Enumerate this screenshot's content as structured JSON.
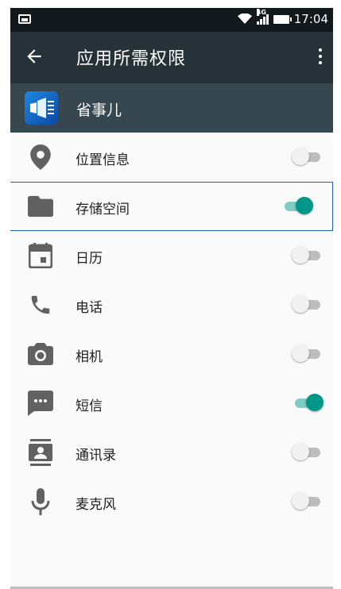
{
  "status_bar": {
    "time": "17:04",
    "network": "4G"
  },
  "toolbar": {
    "title": "应用所需权限",
    "back_icon": "arrow-left-icon",
    "menu_icon": "more-vert-icon"
  },
  "app": {
    "name": "省事儿",
    "icon": "app-logo-icon"
  },
  "colors": {
    "toolbar_bg": "#263238",
    "appbar_bg": "#37474f",
    "switch_on": "#009688",
    "icon_gray": "#616161"
  },
  "permissions": [
    {
      "label": "位置信息",
      "icon": "location-pin-icon",
      "enabled": false
    },
    {
      "label": "存储空间",
      "icon": "folder-icon",
      "enabled": true
    },
    {
      "label": "日历",
      "icon": "calendar-icon",
      "enabled": false
    },
    {
      "label": "电话",
      "icon": "phone-icon",
      "enabled": false
    },
    {
      "label": "相机",
      "icon": "camera-icon",
      "enabled": false
    },
    {
      "label": "短信",
      "icon": "sms-icon",
      "enabled": true
    },
    {
      "label": "通讯录",
      "icon": "contacts-icon",
      "enabled": false
    },
    {
      "label": "麦克风",
      "icon": "microphone-icon",
      "enabled": false
    }
  ]
}
